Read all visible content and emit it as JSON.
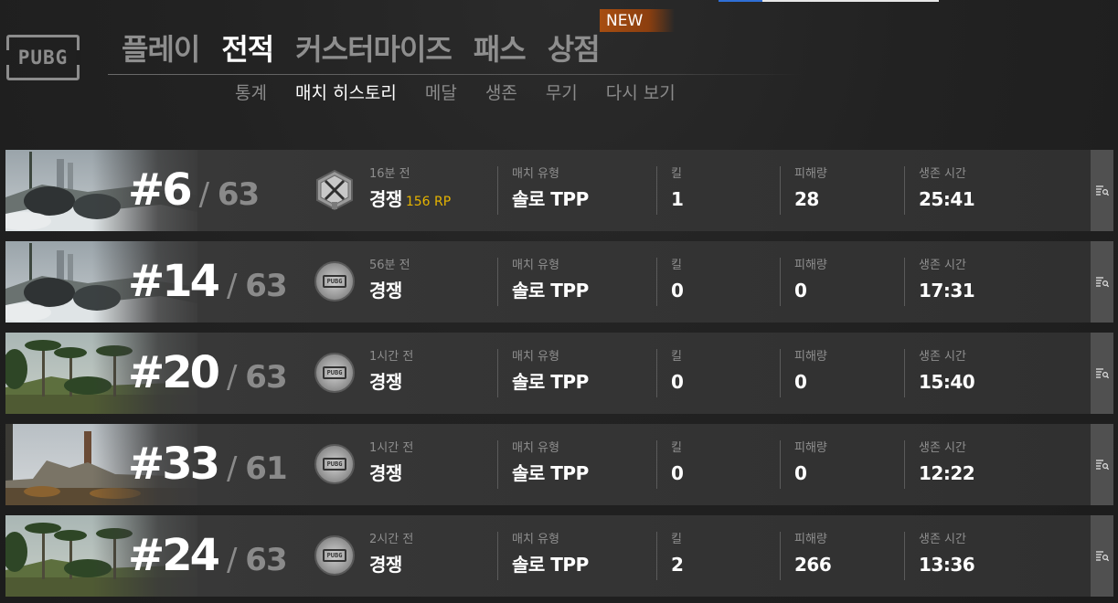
{
  "logo": {
    "text": "PUBG"
  },
  "main_nav": {
    "items": [
      {
        "label": "플레이",
        "active": false
      },
      {
        "label": "전적",
        "active": true
      },
      {
        "label": "커스터마이즈",
        "active": false
      },
      {
        "label": "패스",
        "active": false
      },
      {
        "label": "상점",
        "active": false
      }
    ],
    "new_badge": "NEW"
  },
  "sub_nav": {
    "items": [
      {
        "label": "통계",
        "active": false
      },
      {
        "label": "매치 히스토리",
        "active": true
      },
      {
        "label": "메달",
        "active": false
      },
      {
        "label": "생존",
        "active": false
      },
      {
        "label": "무기",
        "active": false
      },
      {
        "label": "다시 보기",
        "active": false
      }
    ]
  },
  "labels": {
    "match_type": "매치 유형",
    "kills": "킬",
    "damage": "피해량",
    "survival": "생존 시간"
  },
  "matches": [
    {
      "rank": "#6",
      "total": "63",
      "map": "snow",
      "icon": "crossed-guns-icon",
      "time_ago": "16분 전",
      "mode": "경쟁",
      "rp": "156 RP",
      "match_type": "솔로 TPP",
      "kills": "1",
      "damage": "28",
      "survival": "25:41"
    },
    {
      "rank": "#14",
      "total": "63",
      "map": "snow",
      "icon": "pubg-badge-icon",
      "time_ago": "56분 전",
      "mode": "경쟁",
      "rp": "",
      "match_type": "솔로 TPP",
      "kills": "0",
      "damage": "0",
      "survival": "17:31"
    },
    {
      "rank": "#20",
      "total": "63",
      "map": "jungle",
      "icon": "pubg-badge-icon",
      "time_ago": "1시간 전",
      "mode": "경쟁",
      "rp": "",
      "match_type": "솔로 TPP",
      "kills": "0",
      "damage": "0",
      "survival": "15:40"
    },
    {
      "rank": "#33",
      "total": "61",
      "map": "plains",
      "icon": "pubg-badge-icon",
      "time_ago": "1시간 전",
      "mode": "경쟁",
      "rp": "",
      "match_type": "솔로 TPP",
      "kills": "0",
      "damage": "0",
      "survival": "12:22"
    },
    {
      "rank": "#24",
      "total": "63",
      "map": "jungle",
      "icon": "pubg-badge-icon",
      "time_ago": "2시간 전",
      "mode": "경쟁",
      "rp": "",
      "match_type": "솔로 TPP",
      "kills": "2",
      "damage": "266",
      "survival": "13:36"
    }
  ]
}
